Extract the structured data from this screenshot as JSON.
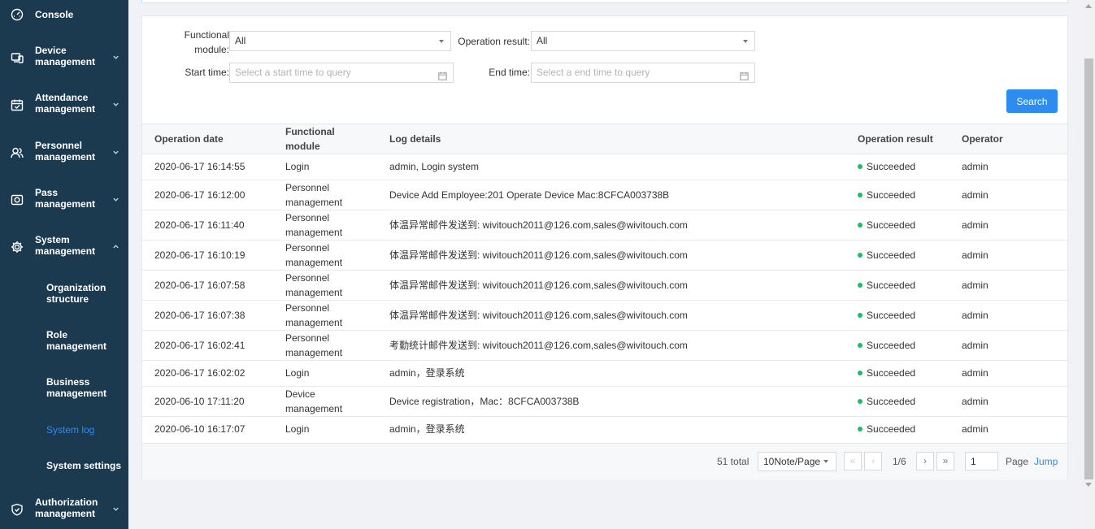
{
  "sidebar": {
    "console": {
      "label": "Console",
      "icon": "gauge-icon"
    },
    "device": {
      "label": "Device management",
      "icon": "devices-icon"
    },
    "attendance": {
      "label": "Attendance management",
      "icon": "calendar-check-icon"
    },
    "personnel": {
      "label": "Personnel management",
      "icon": "users-icon"
    },
    "pass": {
      "label": "Pass management",
      "icon": "camera-icon"
    },
    "system": {
      "label": "System management",
      "icon": "gear-icon"
    },
    "authorization": {
      "label": "Authorization management",
      "icon": "shield-check-icon"
    },
    "system_sub": {
      "org": "Organization structure",
      "role": "Role management",
      "business": "Business management",
      "log": "System log",
      "settings": "System settings"
    }
  },
  "filters": {
    "functional_module_label": "Functional module:",
    "functional_module_value": "All",
    "operation_result_label": "Operation result:",
    "operation_result_value": "All",
    "start_time_label": "Start time:",
    "start_time_placeholder": "Select a start time to query",
    "end_time_label": "End time:",
    "end_time_placeholder": "Select a end time to query",
    "search_label": "Search"
  },
  "table": {
    "headers": {
      "date": "Operation date",
      "module": "Functional module",
      "details": "Log details",
      "result": "Operation result",
      "operator": "Operator"
    },
    "rows": [
      {
        "date": "2020-06-17 16:14:55",
        "module": "Login",
        "details": "admin, Login system",
        "result": "Succeeded",
        "operator": "admin"
      },
      {
        "date": "2020-06-17 16:12:00",
        "module": "Personnel management",
        "details": "Device Add Employee:201 Operate Device Mac:8CFCA003738B",
        "result": "Succeeded",
        "operator": "admin"
      },
      {
        "date": "2020-06-17 16:11:40",
        "module": "Personnel management",
        "details": "体温异常邮件发送到: wivitouch2011@126.com,sales@wivitouch.com",
        "result": "Succeeded",
        "operator": "admin"
      },
      {
        "date": "2020-06-17 16:10:19",
        "module": "Personnel management",
        "details": "体温异常邮件发送到: wivitouch2011@126.com,sales@wivitouch.com",
        "result": "Succeeded",
        "operator": "admin"
      },
      {
        "date": "2020-06-17 16:07:58",
        "module": "Personnel management",
        "details": "体温异常邮件发送到: wivitouch2011@126.com,sales@wivitouch.com",
        "result": "Succeeded",
        "operator": "admin"
      },
      {
        "date": "2020-06-17 16:07:38",
        "module": "Personnel management",
        "details": "体温异常邮件发送到: wivitouch2011@126.com,sales@wivitouch.com",
        "result": "Succeeded",
        "operator": "admin"
      },
      {
        "date": "2020-06-17 16:02:41",
        "module": "Personnel management",
        "details": "考勤统计邮件发送到: wivitouch2011@126.com,sales@wivitouch.com",
        "result": "Succeeded",
        "operator": "admin"
      },
      {
        "date": "2020-06-17 16:02:02",
        "module": "Login",
        "details": "admin，登录系统",
        "result": "Succeeded",
        "operator": "admin"
      },
      {
        "date": "2020-06-10 17:11:20",
        "module": "Device management",
        "details": "Device registration，Mac：8CFCA003738B",
        "result": "Succeeded",
        "operator": "admin"
      },
      {
        "date": "2020-06-10 16:17:07",
        "module": "Login",
        "details": "admin，登录系统",
        "result": "Succeeded",
        "operator": "admin"
      }
    ],
    "status_color": "#19be6b"
  },
  "pagination": {
    "total": "51 total",
    "page_size": "10Note/Page",
    "first": "«",
    "prev": "‹",
    "current": "1/6",
    "next": "›",
    "last": "»",
    "jump_value": "1",
    "page_label": "Page",
    "jump_label": "Jump"
  },
  "colors": {
    "sidebar_bg": "#1b3a4f",
    "accent": "#2d8cf0"
  }
}
